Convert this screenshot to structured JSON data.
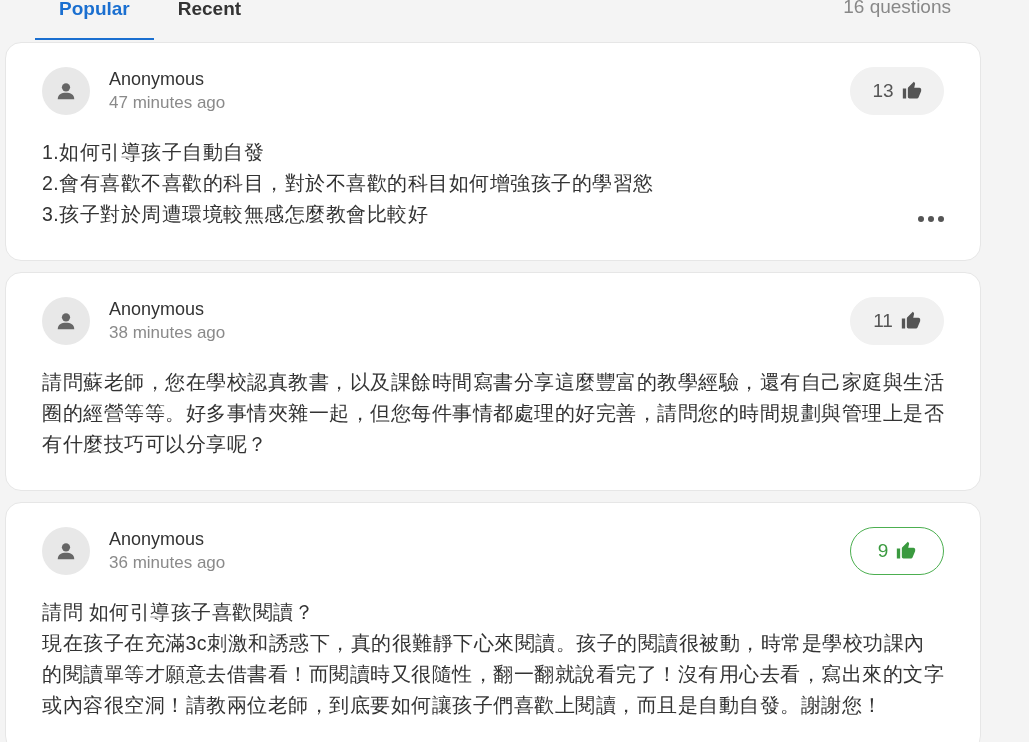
{
  "tabs": [
    {
      "label": "Popular",
      "selected": true
    },
    {
      "label": "Recent",
      "selected": false
    }
  ],
  "question_count": "16 questions",
  "questions": [
    {
      "author": "Anonymous",
      "time": "47 minutes ago",
      "likes": "13",
      "liked": false,
      "menu": true,
      "paragraphs": [
        "1.如何引導孩子自動自發",
        "2.會有喜歡不喜歡的科目，對於不喜歡的科目如何增強孩子的學習慾",
        "3.孩子對於周遭環境較無感怎麼教會比較好"
      ]
    },
    {
      "author": "Anonymous",
      "time": "38 minutes ago",
      "likes": "11",
      "liked": false,
      "menu": false,
      "paragraphs": [
        "請問蘇老師，您在學校認真教書，以及課餘時間寫書分享這麼豐富的教學經驗，還有自己家庭與生活圈的經營等等。好多事情夾雜一起，但您每件事情都處理的好完善，請問您的時間規劃與管理上是否有什麼技巧可以分享呢？"
      ]
    },
    {
      "author": "Anonymous",
      "time": "36 minutes ago",
      "likes": "9",
      "liked": true,
      "menu": false,
      "paragraphs": [
        "請問 如何引導孩子喜歡閱讀？",
        "現在孩子在充滿3c刺激和誘惑下，真的很難靜下心來閱讀。孩子的閱讀很被動，時常是學校功課內的閱讀單等才願意去借書看！而閱讀時又很隨性，翻一翻就說看完了！沒有用心去看，寫出來的文字或內容很空洞！請教兩位老師，到底要如何讓孩子們喜歡上閱讀，而且是自動自發。謝謝您！"
      ]
    }
  ]
}
